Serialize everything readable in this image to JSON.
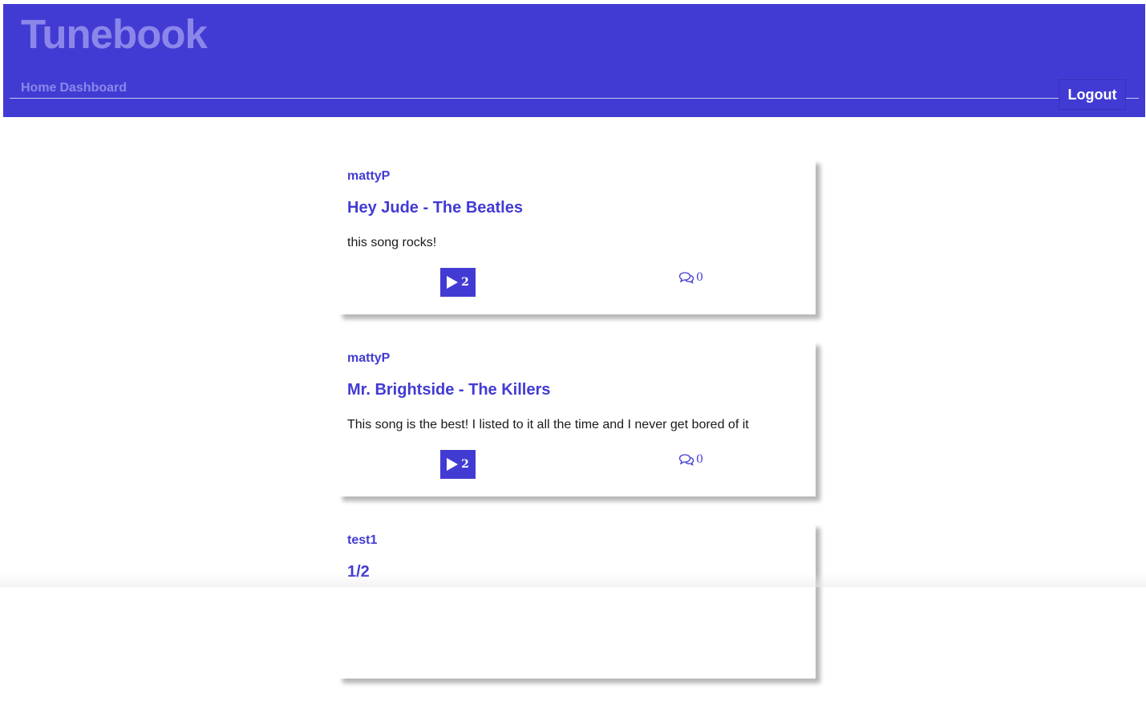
{
  "app": {
    "brand": "Tunebook"
  },
  "nav": {
    "home_label": "Home",
    "dashboard_label": "Dashboard",
    "logout_label": "Logout"
  },
  "colors": {
    "accent": "#423bd3",
    "brand_faded": "#8b87ea"
  },
  "posts": [
    {
      "user": "mattyP",
      "title": "Hey Jude - The Beatles",
      "body": "this song rocks!",
      "plays": "2",
      "comments": "0"
    },
    {
      "user": "mattyP",
      "title": "Mr. Brightside - The Killers",
      "body": "This song is the best! I listed to it all the time and I never get bored of it",
      "plays": "2",
      "comments": "0"
    },
    {
      "user": "test1",
      "title": "1/2",
      "body": "",
      "plays": "",
      "comments": ""
    }
  ],
  "icons": {
    "play": "play-icon",
    "comment": "comment-icon"
  }
}
